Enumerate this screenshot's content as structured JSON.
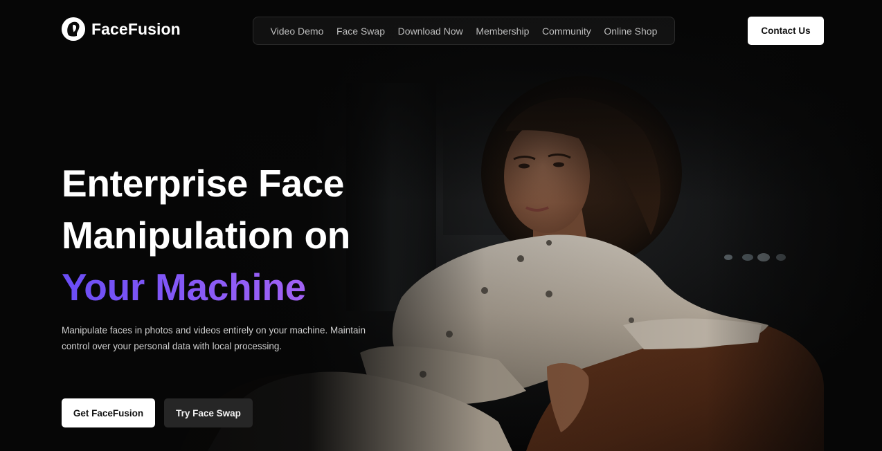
{
  "header": {
    "brand": {
      "name": "FaceFusion",
      "logo_icon": "face-silhouette-logo-icon"
    },
    "nav": {
      "items": [
        {
          "label": "Video Demo"
        },
        {
          "label": "Face Swap"
        },
        {
          "label": "Download Now"
        },
        {
          "label": "Membership"
        },
        {
          "label": "Community"
        },
        {
          "label": "Online Shop"
        }
      ]
    },
    "contact_label": "Contact Us"
  },
  "hero": {
    "headline_line1": "Enterprise Face",
    "headline_line2": "Manipulation on",
    "headline_accent": "Your Machine",
    "subtext": "Manipulate faces in photos and videos entirely on your machine. Maintain control over your personal data with local processing.",
    "primary_cta": "Get FaceFusion",
    "secondary_cta": "Try Face Swap",
    "image": "woman-in-beige-jacket-photo"
  },
  "colors": {
    "background": "#060606",
    "accent_gradient_start": "#6a4df5",
    "accent_gradient_end": "#c06af0",
    "button_light": "#ffffff",
    "button_dark": "#262626"
  }
}
